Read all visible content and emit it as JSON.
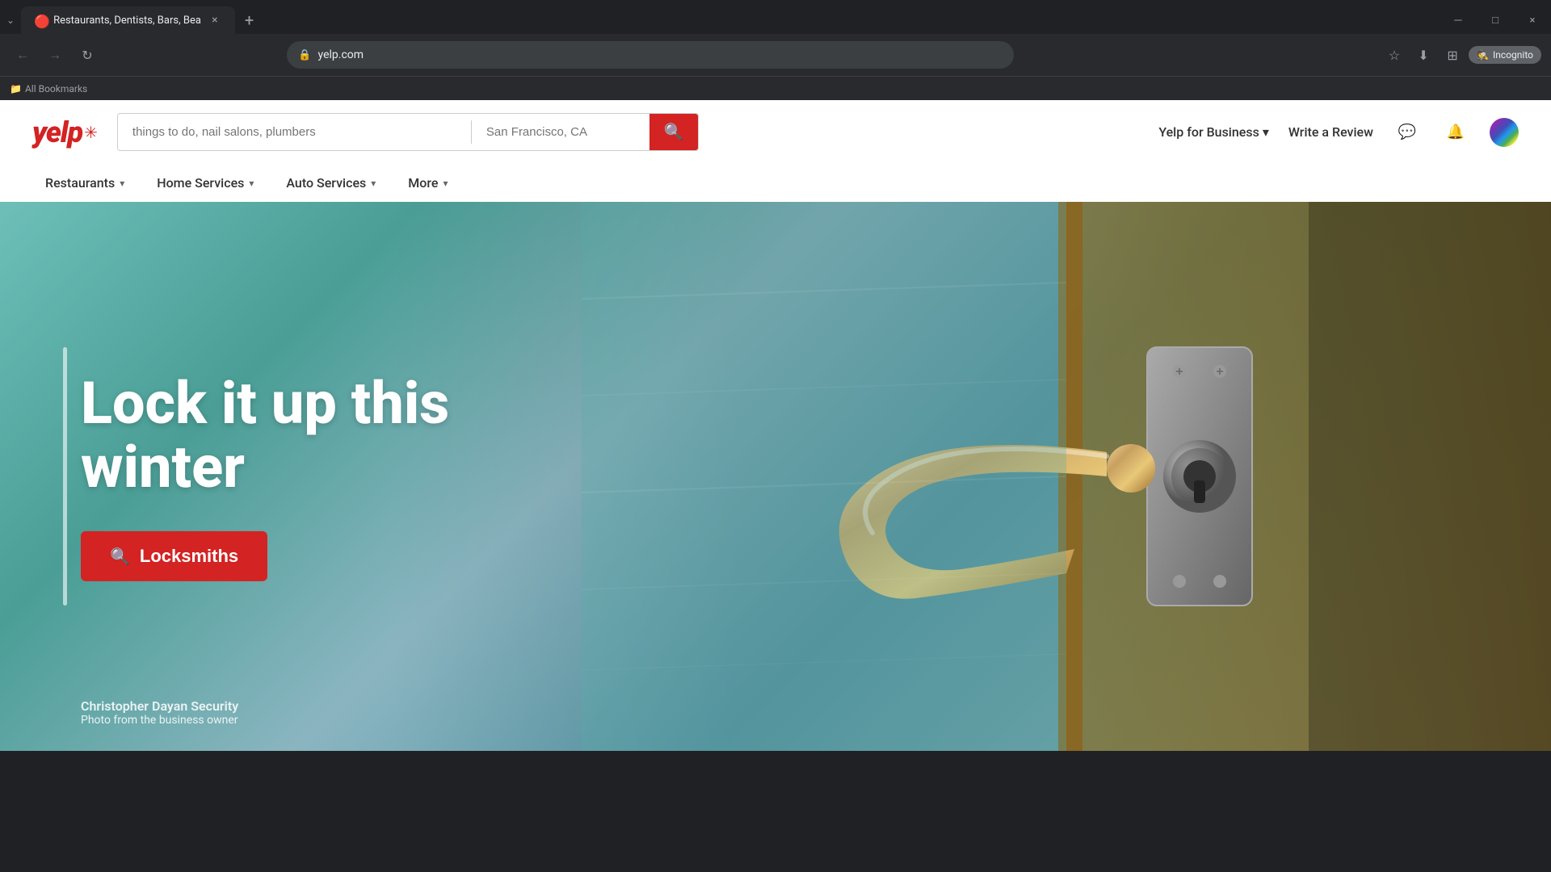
{
  "browser": {
    "tab": {
      "title": "Restaurants, Dentists, Bars, Bea",
      "favicon": "🔴",
      "close_label": "×"
    },
    "new_tab_label": "+",
    "window_controls": {
      "minimize": "─",
      "maximize": "□",
      "close": "×"
    },
    "nav": {
      "back_disabled": true,
      "forward_disabled": true,
      "refresh_label": "↻"
    },
    "address": "yelp.com",
    "toolbar": {
      "bookmark_icon": "☆",
      "download_icon": "⬇",
      "extensions_icon": "⊞",
      "incognito_label": "Incognito"
    },
    "bookmarks_bar": {
      "folder_icon": "📁",
      "text": "All Bookmarks"
    }
  },
  "yelp": {
    "logo_text": "yelp",
    "search": {
      "placeholder": "things to do, nail salons, plumbers",
      "location_placeholder": "San Francisco, CA",
      "button_icon": "🔍"
    },
    "header": {
      "business_label": "Yelp for Business",
      "write_review_label": "Write a Review",
      "chat_icon": "💬",
      "bell_icon": "🔔"
    },
    "nav": {
      "items": [
        {
          "label": "Restaurants",
          "has_dropdown": true
        },
        {
          "label": "Home Services",
          "has_dropdown": true
        },
        {
          "label": "Auto Services",
          "has_dropdown": true
        },
        {
          "label": "More",
          "has_dropdown": true
        }
      ]
    },
    "hero": {
      "title_line1": "Lock it up this",
      "title_line2": "winter",
      "cta_label": "Locksmiths",
      "credit_name": "Christopher Dayan Security",
      "credit_sub": "Photo from the business owner"
    }
  }
}
